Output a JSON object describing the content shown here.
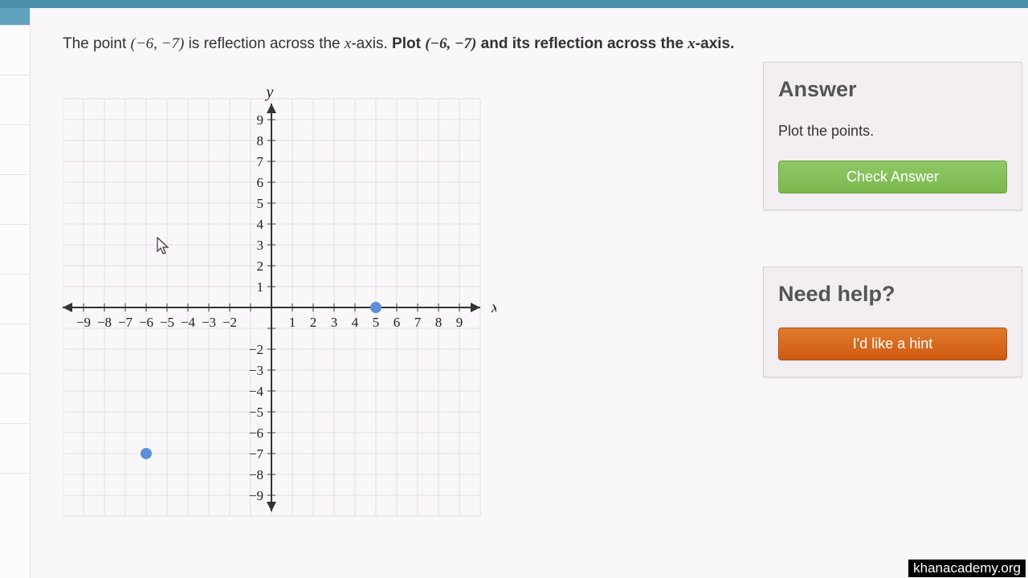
{
  "question": {
    "pre": "The point ",
    "point1": "(−6, −7)",
    "mid1": " is reflection across the ",
    "x_axis": "x",
    "mid2": "-axis. ",
    "plot_word": "Plot ",
    "point2": "(−6, −7)",
    "mid3": " and its reflection across the ",
    "x_axis2": "x",
    "mid4": "-axis."
  },
  "answer_panel": {
    "heading": "Answer",
    "instruction": "Plot the points.",
    "button": "Check Answer"
  },
  "help_panel": {
    "heading": "Need help?",
    "button": "I'd like a hint"
  },
  "watermark": "khanacademy.org",
  "chart_data": {
    "type": "scatter",
    "x_range": [
      -9,
      9
    ],
    "y_range": [
      -9,
      9
    ],
    "xlabel": "x",
    "ylabel": "y",
    "points": [
      {
        "x": 5,
        "y": 0
      },
      {
        "x": -6,
        "y": -7
      }
    ],
    "x_ticks_neg": [
      -9,
      -8,
      -7,
      -6,
      -5,
      -4,
      -3,
      -2
    ],
    "x_ticks_pos": [
      1,
      2,
      3,
      4,
      5,
      6,
      7,
      8,
      9
    ],
    "y_ticks_pos": [
      1,
      2,
      3,
      4,
      5,
      6,
      7,
      8,
      9
    ],
    "y_ticks_neg": [
      -2,
      -3,
      -4,
      -5,
      -6,
      -7,
      -8,
      -9
    ]
  }
}
